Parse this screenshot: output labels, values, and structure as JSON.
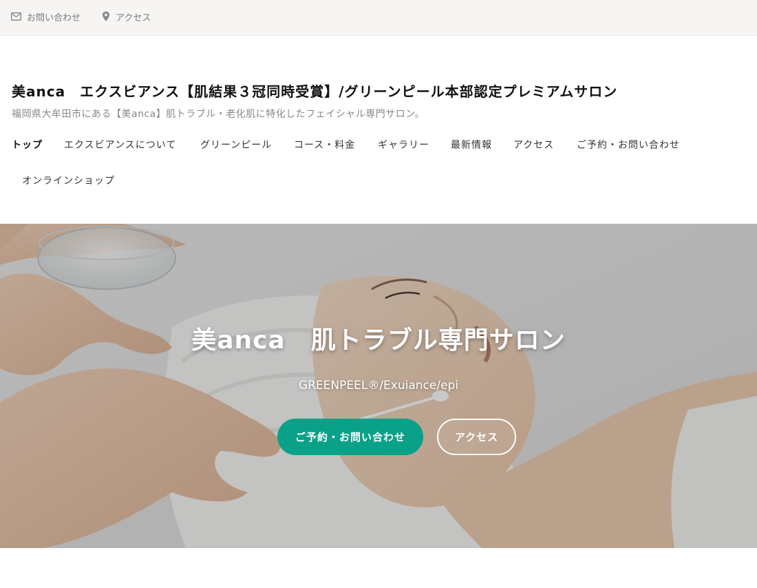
{
  "topbar": {
    "contact_label": "お問い合わせ",
    "access_label": "アクセス",
    "contact_icon": "mail-icon",
    "access_icon": "map-pin-icon"
  },
  "header": {
    "site_title": "美anca　エクスビアンス【肌結果３冠同時受賞】/グリーンピール本部認定プレミアムサロン",
    "tagline": "福岡県大牟田市にある【美anca】肌トラブル・老化肌に特化したフェイシャル専門サロン。"
  },
  "nav": {
    "items": [
      {
        "label": "トップ"
      },
      {
        "label": "エクスビアンスについて"
      },
      {
        "label": "グリーンピール"
      },
      {
        "label": "コース・料金"
      },
      {
        "label": "ギャラリー"
      },
      {
        "label": "最新情報"
      },
      {
        "label": "アクセス"
      },
      {
        "label": "ご予約・お問い合わせ"
      },
      {
        "label": "オンラインショップ"
      }
    ]
  },
  "hero": {
    "title": "美anca　肌トラブル専門サロン",
    "subtitle": "GREENPEEL®/Exuiance/epi",
    "primary_button": "ご予約・お問い合わせ",
    "secondary_button": "アクセス"
  },
  "colors": {
    "accent": "#0aa189",
    "topbar_bg": "#f6f5f3"
  }
}
